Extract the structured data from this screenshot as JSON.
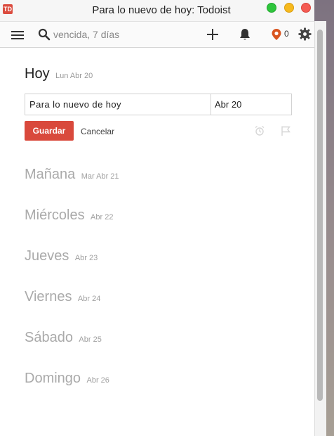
{
  "window": {
    "logo_text": "TD",
    "title": "Para lo nuevo de hoy: Todoist"
  },
  "toolbar": {
    "search_placeholder": "vencida, 7 días",
    "karma_count": "0"
  },
  "today": {
    "name": "Hoy",
    "date": "Lun Abr 20"
  },
  "editor": {
    "task_text": "Para lo nuevo de hoy",
    "date_text": "Abr 20",
    "save_label": "Guardar",
    "cancel_label": "Cancelar"
  },
  "days": [
    {
      "name": "Mañana",
      "date": "Mar Abr 21"
    },
    {
      "name": "Miércoles",
      "date": "Abr 22"
    },
    {
      "name": "Jueves",
      "date": "Abr 23"
    },
    {
      "name": "Viernes",
      "date": "Abr 24"
    },
    {
      "name": "Sábado",
      "date": "Abr 25"
    },
    {
      "name": "Domingo",
      "date": "Abr 26"
    }
  ],
  "colors": {
    "accent": "#db4c3f",
    "upcoming_text": "#aaaaaa"
  },
  "icons": [
    "menu-icon",
    "search-icon",
    "add-icon",
    "bell-icon",
    "karma-icon",
    "gear-icon",
    "alarm-icon",
    "flag-icon"
  ]
}
